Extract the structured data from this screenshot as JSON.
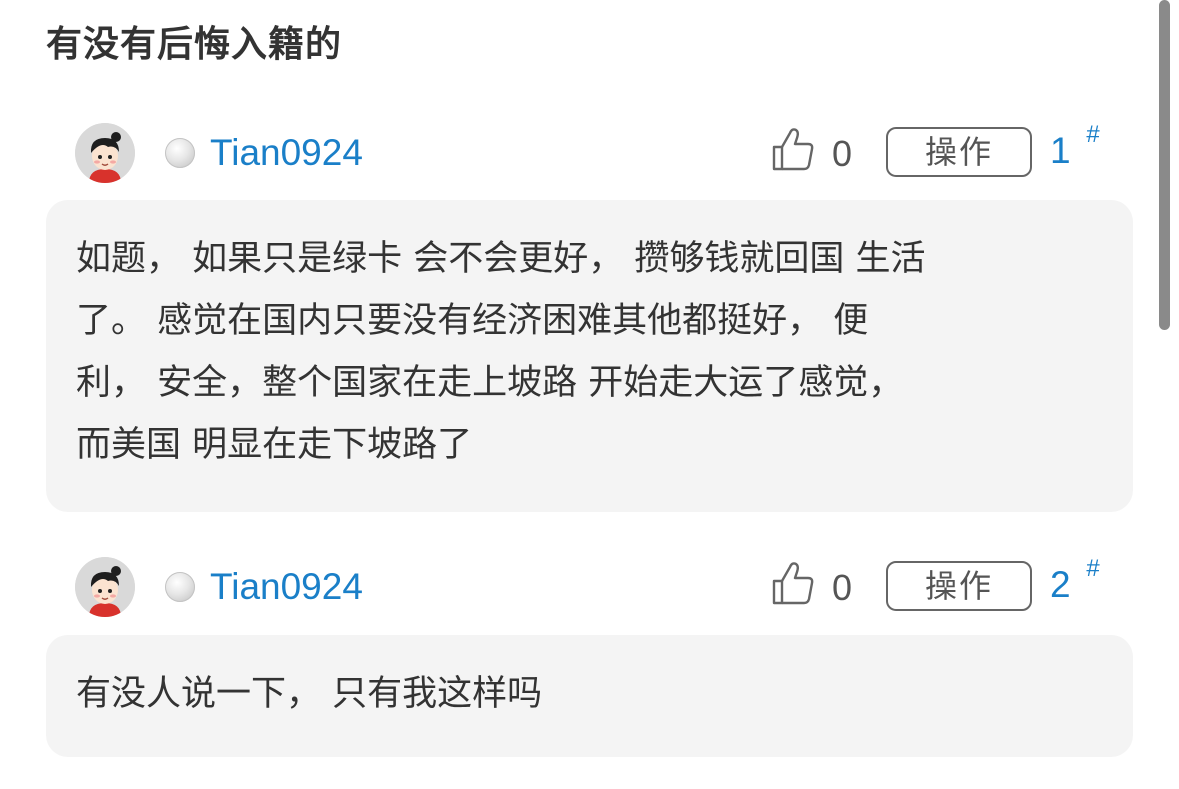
{
  "thread": {
    "title": "有没有后悔入籍的"
  },
  "colors": {
    "username": "#1a7fc8",
    "body_background": "#f4f4f4",
    "title": "#333333"
  },
  "posts": [
    {
      "username": "Tian0924",
      "avatar_icon": "cartoon-avatar",
      "status_icon": "offline-dot",
      "like_icon": "thumbs-up-icon",
      "likes": "0",
      "action_label": "操作",
      "floor": "1",
      "floor_mark": "#",
      "content_lines": [
        "如题， 如果只是绿卡 会不会更好， 攒够钱就回国 生活",
        "了。 感觉在国内只要没有经济困难其他都挺好， 便",
        "利， 安全，整个国家在走上坡路 开始走大运了感觉，",
        "而美国 明显在走下坡路了"
      ]
    },
    {
      "username": "Tian0924",
      "avatar_icon": "cartoon-avatar",
      "status_icon": "offline-dot",
      "like_icon": "thumbs-up-icon",
      "likes": "0",
      "action_label": "操作",
      "floor": "2",
      "floor_mark": "#",
      "content_lines": [
        "有没人说一下， 只有我这样吗"
      ]
    }
  ]
}
